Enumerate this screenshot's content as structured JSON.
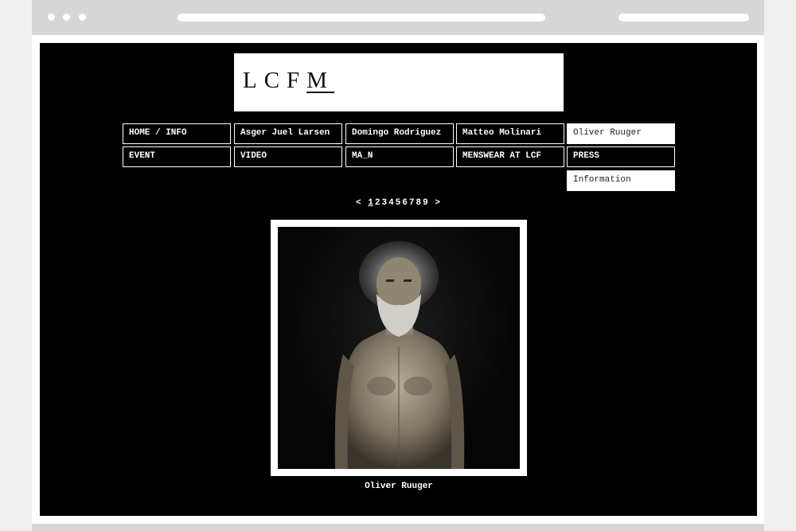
{
  "logo": {
    "main": "LCF",
    "underlined": "M"
  },
  "nav": [
    "HOME / INFO",
    "Asger Juel Larsen",
    "Domingo Rodriguez",
    "Matteo Molinari",
    "Oliver Ruuger",
    "EVENT",
    "VIDEO",
    "MA_N",
    "MENSWEAR AT LCF",
    "PRESS",
    "Information"
  ],
  "pager": {
    "prev": "<",
    "pages": [
      "1",
      "2",
      "3",
      "4",
      "5",
      "6",
      "7",
      "8",
      "9"
    ],
    "next": ">"
  },
  "photo": {
    "caption": "Oliver Ruuger"
  }
}
